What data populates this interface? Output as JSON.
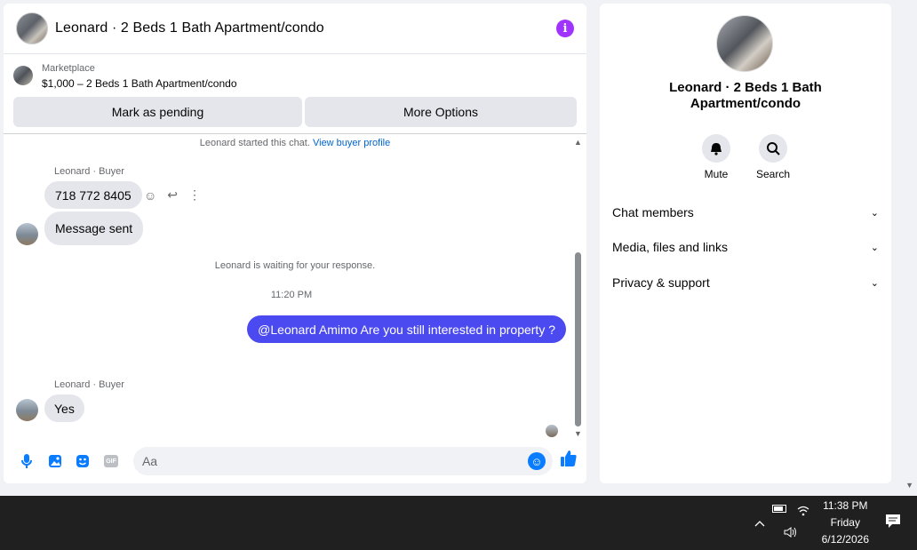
{
  "chat": {
    "title": "Leonard · 2 Beds 1 Bath Apartment/condo",
    "info_icon": "i",
    "listing": {
      "source": "Marketplace",
      "description": "$1,000 – 2 Beds 1 Bath Apartment/condo"
    },
    "actions": {
      "pending": "Mark as pending",
      "more": "More Options"
    },
    "started_text": "Leonard started this chat.",
    "buyer_profile_link": "View buyer profile",
    "messages": [
      {
        "sender": "Leonard · Buyer",
        "text": "718 772 8405"
      },
      {
        "text": "Message sent"
      }
    ],
    "waiting_text": "Leonard is waiting for your response.",
    "timestamp": "11:20 PM",
    "outgoing": "@Leonard Amimo Are you still interested in property ?",
    "reply": {
      "sender": "Leonard · Buyer",
      "text": "Yes"
    },
    "composer": {
      "placeholder": "Aa",
      "gif_label": "GIF"
    }
  },
  "info_panel": {
    "title": "Leonard · 2 Beds 1 Bath Apartment/condo",
    "actions": [
      {
        "label": "Mute",
        "icon": "bell-icon"
      },
      {
        "label": "Search",
        "icon": "search-icon"
      }
    ],
    "sections": [
      "Chat members",
      "Media, files and links",
      "Privacy & support"
    ]
  },
  "taskbar": {
    "time": "11:38 PM",
    "day": "Friday",
    "date": "6/12/2026"
  },
  "colors": {
    "accent": "#4b4af0",
    "messenger_blue": "#0a7cff",
    "info_purple": "#a033ff"
  }
}
